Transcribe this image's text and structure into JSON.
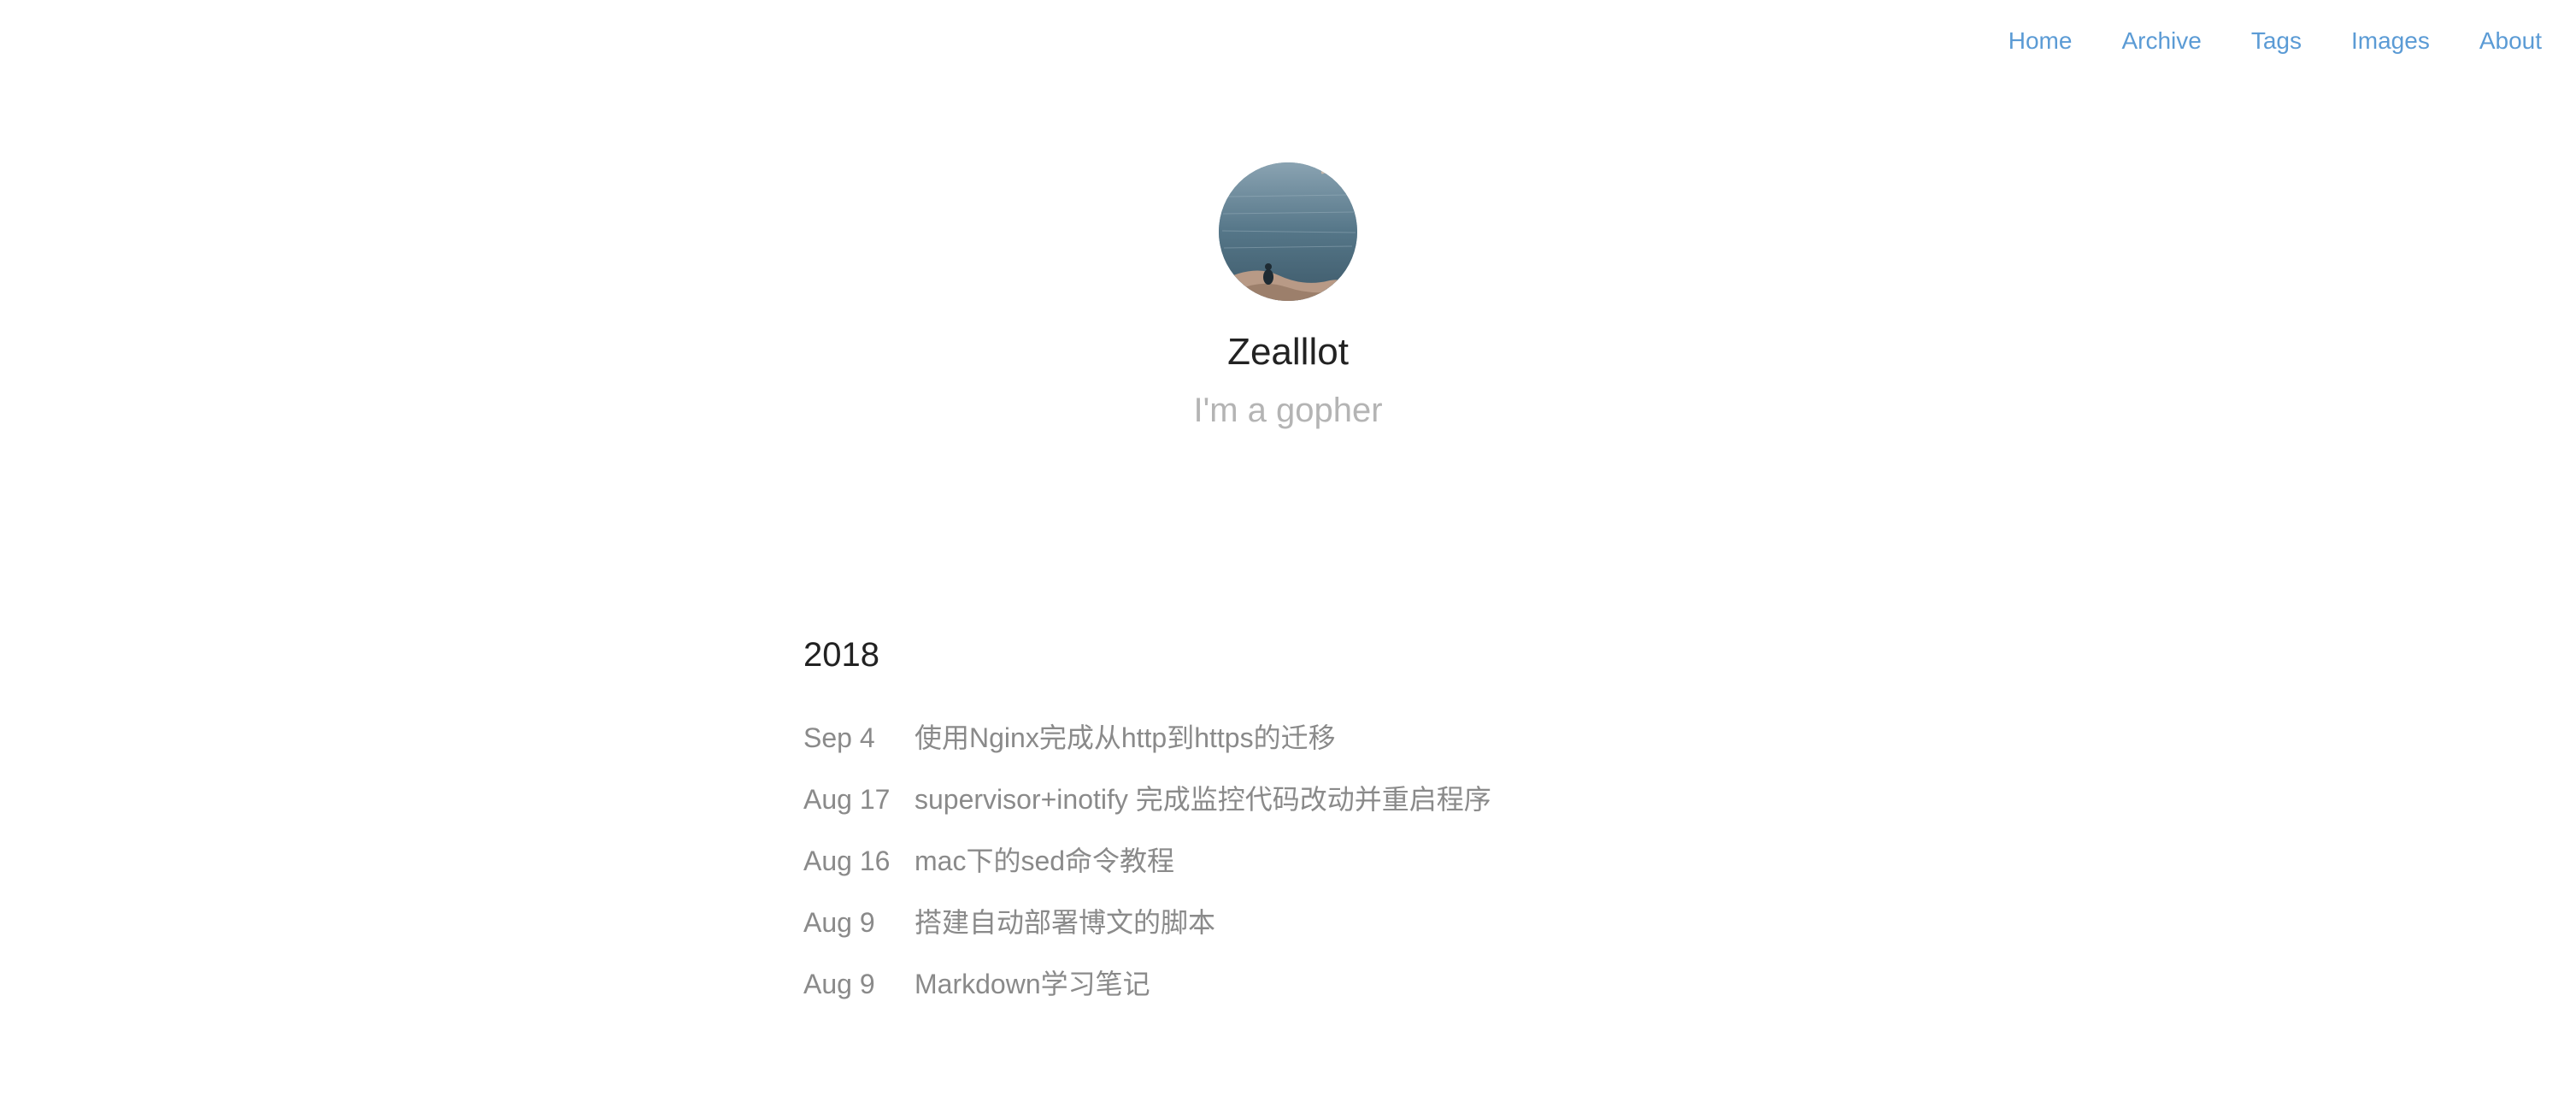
{
  "nav": {
    "items": [
      {
        "label": "Home"
      },
      {
        "label": "Archive"
      },
      {
        "label": "Tags"
      },
      {
        "label": "Images"
      },
      {
        "label": "About"
      }
    ]
  },
  "profile": {
    "name": "Zealllot",
    "tagline": "I'm a gopher",
    "avatar_icon": "avatar-photo"
  },
  "archive": {
    "year": "2018",
    "posts": [
      {
        "date": "Sep 4",
        "title": "使用Nginx完成从http到https的迁移"
      },
      {
        "date": "Aug 17",
        "title": "supervisor+inotify 完成监控代码改动并重启程序"
      },
      {
        "date": "Aug 16",
        "title": "mac下的sed命令教程"
      },
      {
        "date": "Aug 9",
        "title": "搭建自动部署博文的脚本"
      },
      {
        "date": "Aug 9",
        "title": "Markdown学习笔记"
      }
    ]
  },
  "colors": {
    "link": "#5b9bd5",
    "text": "#222222",
    "muted": "#8a8a8a",
    "light": "#b4b4b4"
  }
}
